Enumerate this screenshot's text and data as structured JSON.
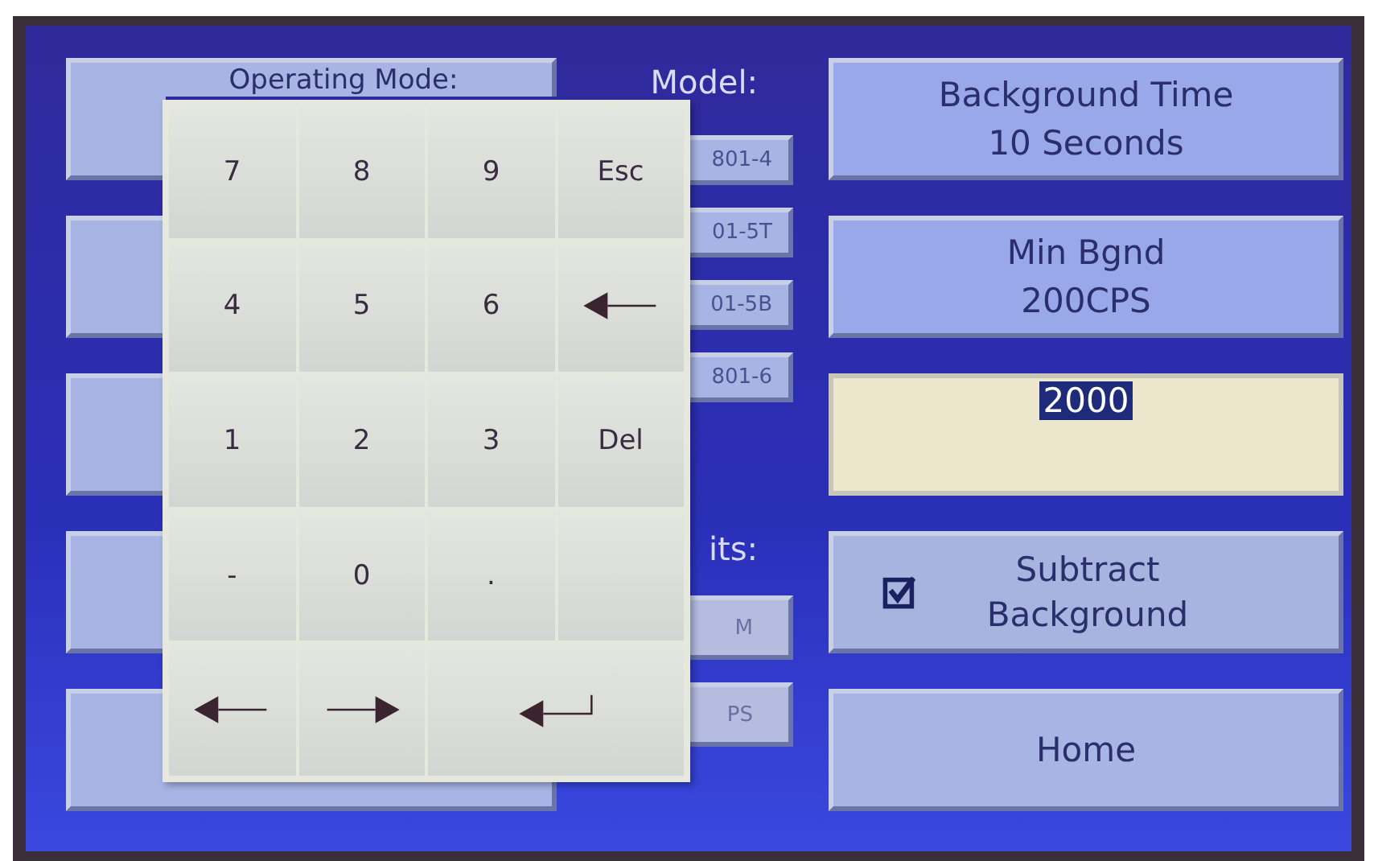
{
  "operating_mode": {
    "label": "Operating Mode:"
  },
  "model": {
    "label": "Model:",
    "options": [
      "801-4",
      "01-5T",
      "01-5B",
      "801-6"
    ]
  },
  "units": {
    "label": "its:",
    "options": [
      "M",
      "PS"
    ]
  },
  "background_time": {
    "title": "Background Time",
    "value": "10 Seconds"
  },
  "min_bgnd": {
    "title": "Min Bgnd",
    "value": "200CPS"
  },
  "entry_field": {
    "value": "2000",
    "selected": true
  },
  "subtract_background": {
    "label": "Subtract Background",
    "checked": true
  },
  "home_button": {
    "label": "Home"
  },
  "keypad": {
    "keys": [
      {
        "kind": "text",
        "label": "7"
      },
      {
        "kind": "text",
        "label": "8"
      },
      {
        "kind": "text",
        "label": "9"
      },
      {
        "kind": "text",
        "label": "Esc"
      },
      {
        "kind": "text",
        "label": "4"
      },
      {
        "kind": "text",
        "label": "5"
      },
      {
        "kind": "text",
        "label": "6"
      },
      {
        "kind": "backspace"
      },
      {
        "kind": "text",
        "label": "1"
      },
      {
        "kind": "text",
        "label": "2"
      },
      {
        "kind": "text",
        "label": "3"
      },
      {
        "kind": "text",
        "label": "Del"
      },
      {
        "kind": "text",
        "label": "-"
      },
      {
        "kind": "text",
        "label": "0"
      },
      {
        "kind": "text",
        "label": "."
      },
      {
        "kind": "blank"
      },
      {
        "kind": "left"
      },
      {
        "kind": "right"
      },
      {
        "kind": "enter"
      }
    ]
  }
}
